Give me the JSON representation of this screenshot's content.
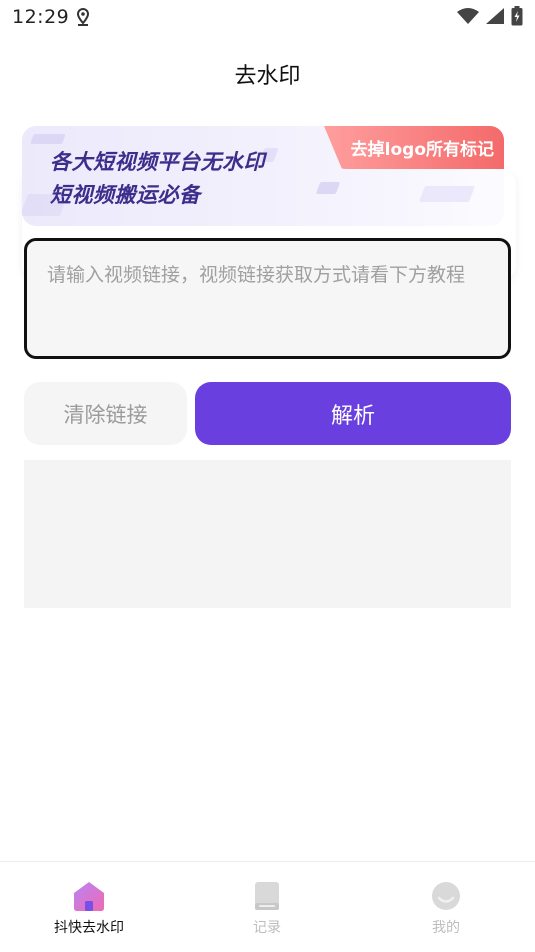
{
  "status_bar": {
    "time": "12:29"
  },
  "header": {
    "title": "去水印"
  },
  "banner": {
    "line1": "各大短视频平台无水印",
    "line2": "短视频搬运必备",
    "tag": "去掉logo所有标记"
  },
  "input": {
    "placeholder": "请输入视频链接，视频链接获取方式请看下方教程",
    "value": ""
  },
  "actions": {
    "clear_label": "清除链接",
    "parse_label": "解析"
  },
  "tabs": [
    {
      "label": "抖快去水印",
      "icon": "home-icon",
      "active": true
    },
    {
      "label": "记录",
      "icon": "book-icon",
      "active": false
    },
    {
      "label": "我的",
      "icon": "smiley-icon",
      "active": false
    }
  ],
  "colors": {
    "accent": "#6a3fe0",
    "tag_gradient_start": "#ff9e9e",
    "tag_gradient_end": "#f46a6a",
    "banner_text": "#3d2e8c"
  }
}
